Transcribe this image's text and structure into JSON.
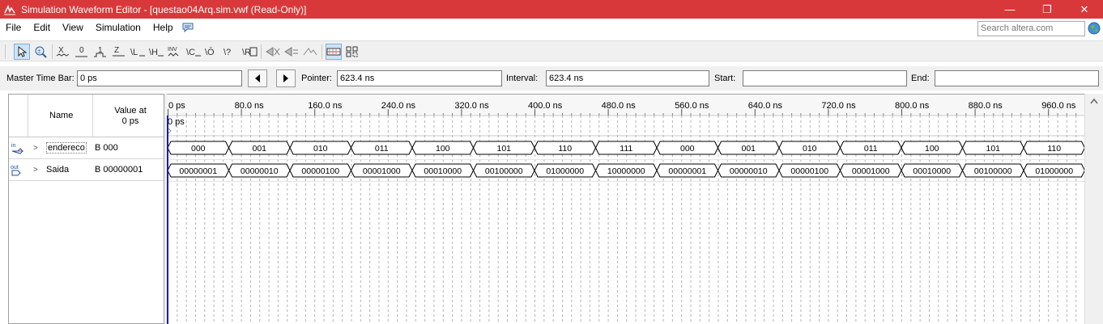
{
  "window": {
    "title": "Simulation Waveform Editor - [questao04Arq.sim.vwf (Read-Only)]",
    "minimize": "—",
    "maximize": "❐",
    "close": "✕"
  },
  "menu": [
    "File",
    "Edit",
    "View",
    "Simulation",
    "Help"
  ],
  "search": {
    "placeholder": "Search altera.com"
  },
  "toolbar_icons": [
    "pointer-tool-icon",
    "zoom-tool-icon",
    "forcing-unknown-icon",
    "forcing-low-icon",
    "forcing-high-icon",
    "weak-unknown-icon",
    "weak-low-icon",
    "weak-high-icon",
    "invert-icon",
    "count-value-icon",
    "clock-icon",
    "random-values-icon",
    "high-impedance-icon",
    "dont-care-icon",
    "arbitrary-value-icon",
    "snap-to-grid-icon",
    "group-icon",
    "ungroup-icon",
    "overwrite-icon",
    "select-all-icon"
  ],
  "timebar": {
    "master_label": "Master Time Bar:",
    "master_value": "0 ps",
    "pointer_label": "Pointer:",
    "pointer_value": "623.4 ns",
    "interval_label": "Interval:",
    "interval_value": "623.4 ns",
    "start_label": "Start:",
    "start_value": "",
    "end_label": "End:",
    "end_value": ""
  },
  "columns": {
    "name": "Name",
    "value_at": "Value at",
    "value_time": "0 ps"
  },
  "signals": [
    {
      "name": "endereco",
      "value": "B 000",
      "icon": "input-pin-icon",
      "icon_label": "in"
    },
    {
      "name": "Saida",
      "value": "B 00000001",
      "icon": "output-pin-icon",
      "icon_label": "out"
    }
  ],
  "timeline": {
    "ticks": [
      "0 ps",
      "80.0 ns",
      "160.0 ns",
      "240.0 ns",
      "320.0 ns",
      "400.0 ns",
      "480.0 ns",
      "560.0 ns",
      "640.0 ns",
      "720.0 ns",
      "800.0 ns",
      "880.0 ns",
      "960.0 ns"
    ],
    "cursor_label": "0 ps"
  },
  "waveforms": {
    "endereco": [
      "000",
      "001",
      "010",
      "011",
      "100",
      "101",
      "110",
      "111",
      "000",
      "001",
      "010",
      "011",
      "100",
      "101",
      "110"
    ],
    "Saida": [
      "00000001",
      "00000010",
      "00000100",
      "00001000",
      "00010000",
      "00100000",
      "01000000",
      "10000000",
      "00000001",
      "00000010",
      "00000100",
      "00001000",
      "00010000",
      "00100000",
      "01000000"
    ]
  },
  "colors": {
    "titlebar": "#d9383a",
    "cursor": "#1b1bb8",
    "grid": "#b4b4b4"
  }
}
